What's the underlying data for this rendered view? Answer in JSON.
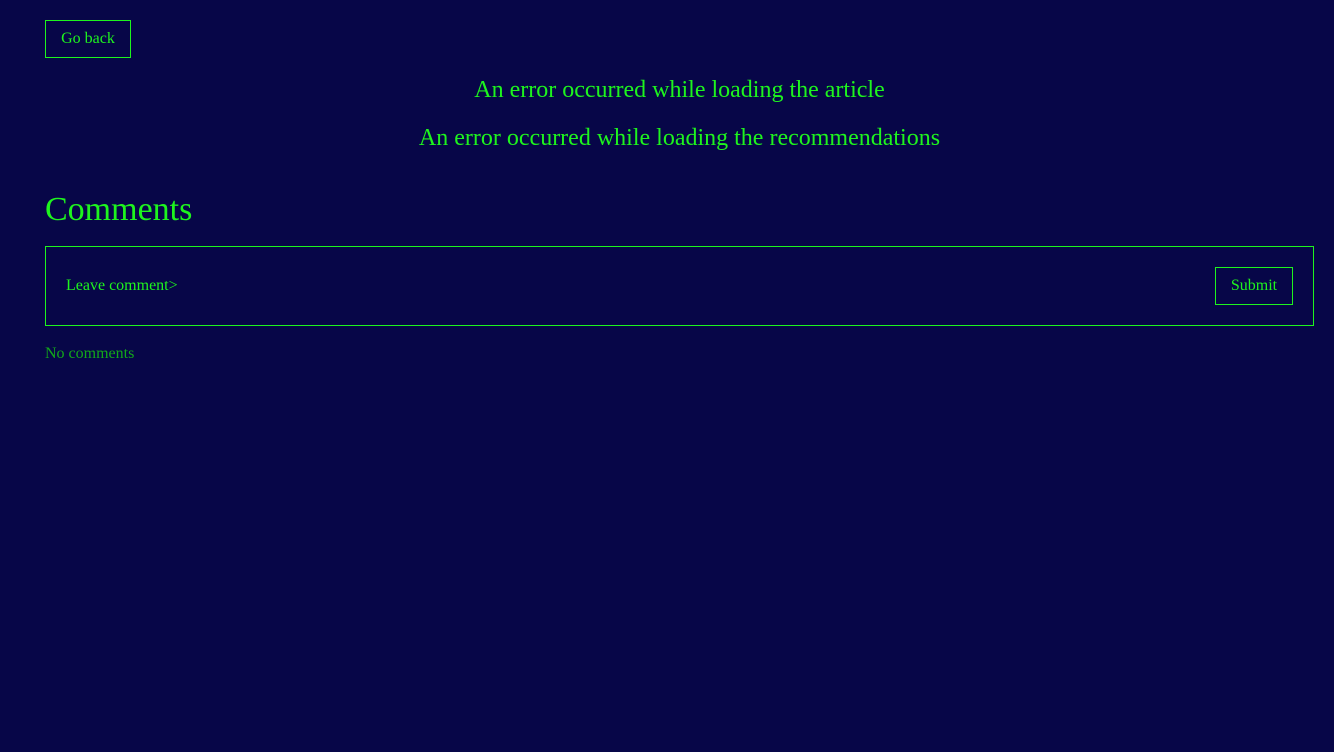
{
  "colors": {
    "background": "#070648",
    "accent": "#1ef41e",
    "muted": "#12a81a"
  },
  "nav": {
    "back_label": "Go back"
  },
  "errors": {
    "article": "An error occurred while loading the article",
    "recommendations": "An error occurred while loading the recommendations"
  },
  "comments": {
    "title": "Comments",
    "input_value": "",
    "input_placeholder": "Leave comment>",
    "submit_label": "Submit",
    "empty_text": "No comments"
  }
}
